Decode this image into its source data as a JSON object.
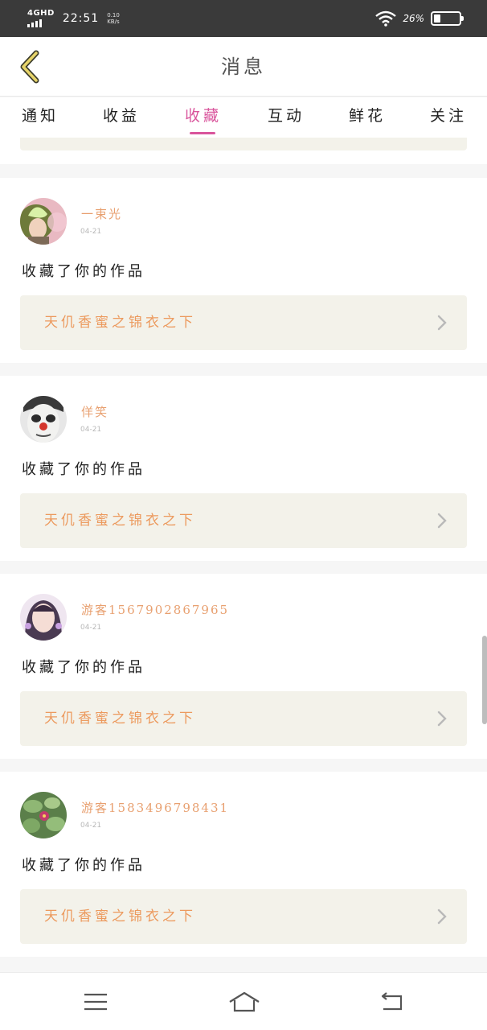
{
  "status_bar": {
    "network": "4GHD",
    "time": "22:51",
    "speed": "0.10\nKB/s",
    "battery_percent": "26%",
    "battery_level": 0.26
  },
  "header": {
    "title": "消息",
    "back_icon": "chevron-left-icon"
  },
  "tabs": [
    {
      "label": "通知",
      "active": false
    },
    {
      "label": "收益",
      "active": false
    },
    {
      "label": "收藏",
      "active": true
    },
    {
      "label": "互动",
      "active": false
    },
    {
      "label": "鲜花",
      "active": false
    },
    {
      "label": "关注",
      "active": false
    }
  ],
  "colors": {
    "accent": "#d9559c",
    "username": "#e8a070",
    "work_title": "#ec9a5e",
    "link_bg": "#f3f2ea"
  },
  "messages": [
    {
      "username": "一束光",
      "date": "04-21",
      "text": "收藏了你的作品",
      "work": "天仉香蜜之锦衣之下"
    },
    {
      "username": "佯笑",
      "date": "04-21",
      "text": "收藏了你的作品",
      "work": "天仉香蜜之锦衣之下"
    },
    {
      "username": "游客1567902867965",
      "date": "04-21",
      "text": "收藏了你的作品",
      "work": "天仉香蜜之锦衣之下"
    },
    {
      "username": "游客1583496798431",
      "date": "04-21",
      "text": "收藏了你的作品",
      "work": "天仉香蜜之锦衣之下"
    }
  ],
  "bottom_nav": {
    "menu_icon": "menu-icon",
    "home_icon": "home-icon",
    "back_icon": "back-arrow-icon"
  }
}
